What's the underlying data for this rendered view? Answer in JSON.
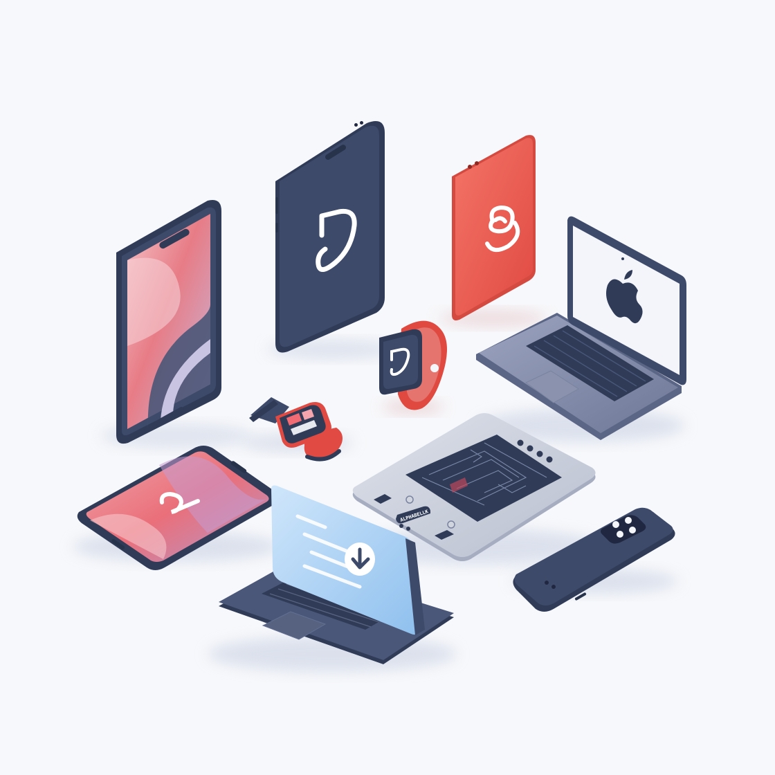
{
  "scene": {
    "background": "#f7f8fb",
    "palette": {
      "navy": "#3d4a6a",
      "navy_dark": "#2f3b57",
      "coral": "#ef5b50",
      "silver": "#c5cad8",
      "sky": "#a9d0f5",
      "white": "#ffffff"
    }
  },
  "devices": {
    "phone_left": {
      "icon": "abstract-wave-wallpaper"
    },
    "phone_back": {
      "icon": "abstract-loop-logo"
    },
    "phone_red": {
      "icon": "abstract-swirl-logo"
    },
    "laptop_right": {
      "icon": "apple-logo"
    },
    "watch_upright": {
      "icon": "abstract-loop-logo"
    },
    "watch_flat": {
      "icon": "color-bars"
    },
    "tablet_left": {
      "icon": "abstract-loop-logo"
    },
    "laptop_front": {
      "icon": "download-arrow-icon"
    },
    "console": {
      "label": "ALPHABELLK",
      "icon": "circuit-schematic"
    },
    "phone_flat": {
      "icon": "quad-camera"
    }
  }
}
